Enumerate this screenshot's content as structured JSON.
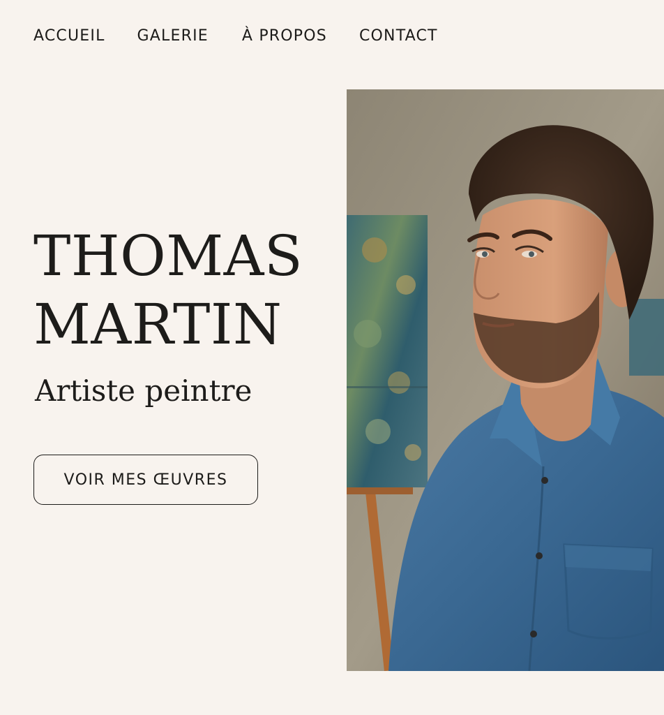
{
  "nav": {
    "items": [
      {
        "label": "ACCUEIL"
      },
      {
        "label": "GALERIE"
      },
      {
        "label": "À PROPOS"
      },
      {
        "label": "CONTACT"
      }
    ]
  },
  "hero": {
    "name_line1": "THOMAS",
    "name_line2": "MARTIN",
    "subtitle": "Artiste peintre",
    "cta_label": "VOIR MES ŒUVRES"
  },
  "portrait": {
    "alt": "Portrait de Thomas Martin"
  },
  "colors": {
    "background": "#f8f3ee",
    "text": "#1c1b19",
    "shirt": "#3d6a93"
  }
}
